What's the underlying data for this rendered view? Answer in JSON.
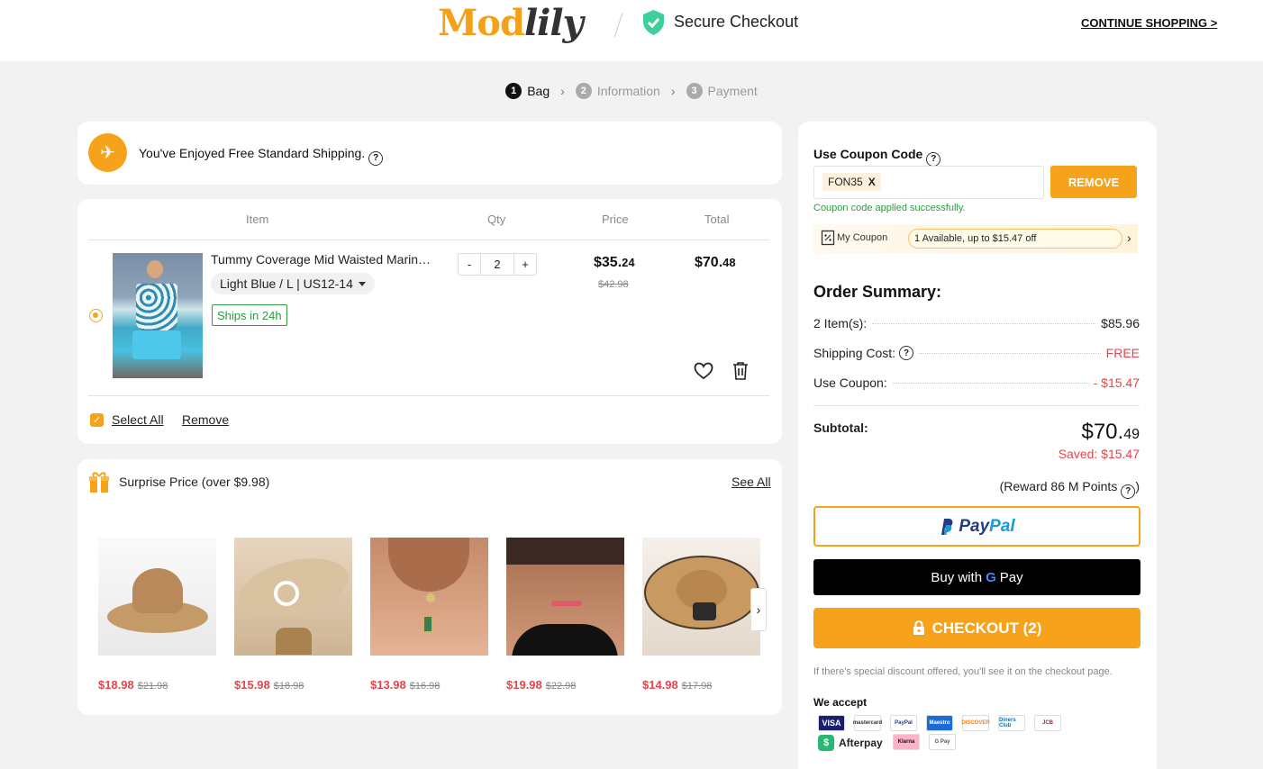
{
  "header": {
    "logo_main": "Mod",
    "logo_script": "lily",
    "secure_label": "Secure Checkout",
    "continue_label": "CONTINUE SHOPPING >"
  },
  "steps": [
    {
      "num": "1",
      "label": "Bag"
    },
    {
      "num": "2",
      "label": "Information"
    },
    {
      "num": "3",
      "label": "Payment"
    }
  ],
  "shipping_banner": {
    "text": "You've Enjoyed Free Standard Shipping."
  },
  "bag": {
    "columns": {
      "item": "Item",
      "qty": "Qty",
      "price": "Price",
      "total": "Total"
    },
    "product": {
      "name": "Tummy Coverage Mid Waisted Marine Print Tankini Set",
      "variant": "Light Blue / L | US12-14",
      "ships_badge": "Ships in 24h",
      "qty_minus": "-",
      "qty": "2",
      "qty_plus": "+",
      "price_main": "$35.",
      "price_cents": "24",
      "price_old": "$42.98",
      "total_main": "$70.",
      "total_cents": "48"
    },
    "select_all": "Select All",
    "remove": "Remove"
  },
  "surprise": {
    "title": "Surprise Price (over $9.98)",
    "see_all": "See All",
    "items": [
      {
        "price": "$18.98",
        "old": "$21.98"
      },
      {
        "price": "$15.98",
        "old": "$18.98"
      },
      {
        "price": "$13.98",
        "old": "$16.98"
      },
      {
        "price": "$19.98",
        "old": "$22.98"
      },
      {
        "price": "$14.98",
        "old": "$17.98"
      }
    ]
  },
  "coupon": {
    "label": "Use Coupon Code",
    "code": "FON35",
    "clear": "X",
    "remove_btn": "REMOVE",
    "success": "Coupon code applied successfully.",
    "my_coupon_label": "My Coupon",
    "available": "1 Available, up to $15.47 off"
  },
  "summary": {
    "title": "Order Summary:",
    "items_label": "2 Item(s):",
    "items_value": "$85.96",
    "shipping_label": "Shipping Cost:",
    "shipping_value": "FREE",
    "coupon_label": "Use Coupon:",
    "coupon_value": "- $15.47",
    "subtotal_label": "Subtotal:",
    "subtotal_main": "$70.",
    "subtotal_cents": "49",
    "saved": "Saved: $15.47",
    "reward": "(Reward 86 M Points"
  },
  "buttons": {
    "paypal_a": "Pay",
    "paypal_b": "Pal",
    "gpay_prefix": "Buy with",
    "gpay_pay": "Pay",
    "checkout": "CHECKOUT (2)"
  },
  "note": "If there's special discount offered, you'll see it on the checkout page.",
  "accept": {
    "label": "We accept",
    "methods": [
      "VISA",
      "mastercard",
      "PayPal",
      "Maestro",
      "DISCOVER",
      "Diners Club",
      "JCB",
      "Afterpay",
      "Klarna",
      "G Pay"
    ]
  },
  "colors": {
    "accent": "#f7a21b",
    "sale_red": "#e0474c",
    "success_green": "#2e9b3f"
  }
}
